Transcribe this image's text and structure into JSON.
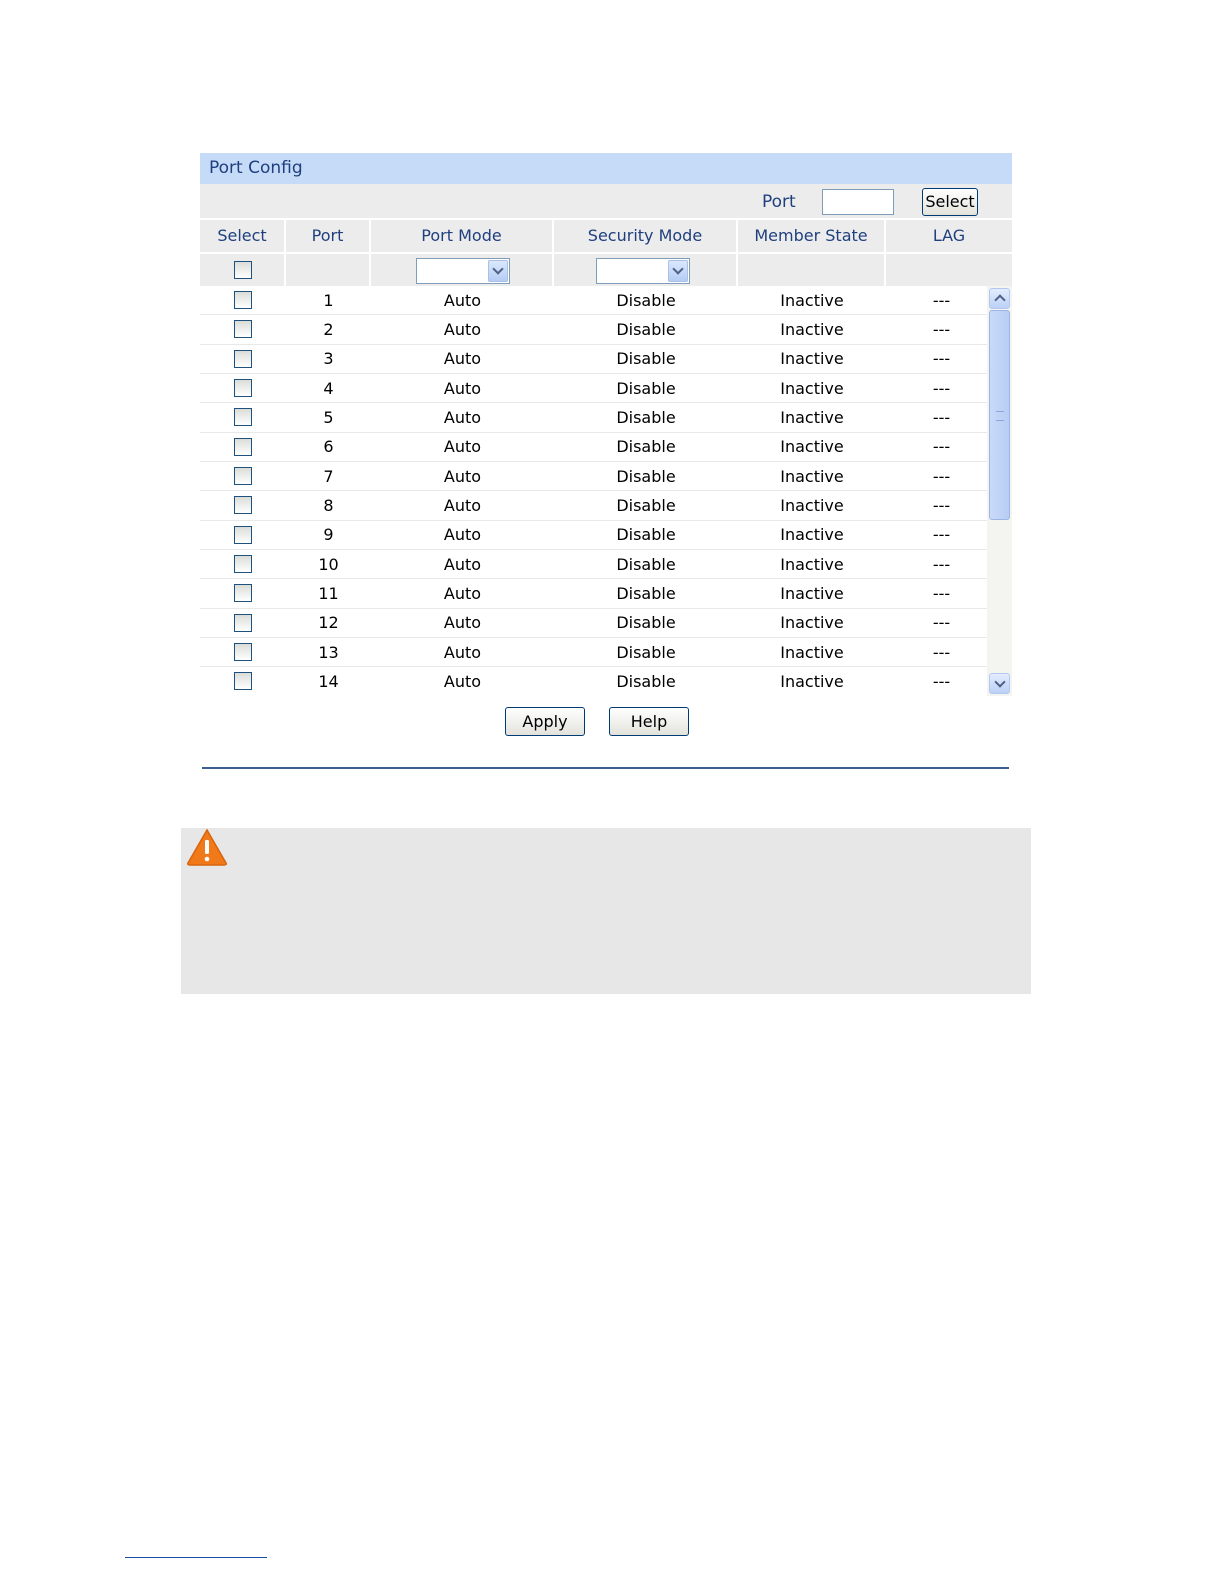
{
  "panel": {
    "title": "Port Config",
    "port_select": {
      "label": "Port",
      "input_value": "",
      "button": "Select"
    },
    "columns": [
      "Select",
      "Port",
      "Port Mode",
      "Security Mode",
      "Member State",
      "LAG"
    ],
    "rows": [
      {
        "port": "1",
        "port_mode": "Auto",
        "security_mode": "Disable",
        "member_state": "Inactive",
        "lag": "---"
      },
      {
        "port": "2",
        "port_mode": "Auto",
        "security_mode": "Disable",
        "member_state": "Inactive",
        "lag": "---"
      },
      {
        "port": "3",
        "port_mode": "Auto",
        "security_mode": "Disable",
        "member_state": "Inactive",
        "lag": "---"
      },
      {
        "port": "4",
        "port_mode": "Auto",
        "security_mode": "Disable",
        "member_state": "Inactive",
        "lag": "---"
      },
      {
        "port": "5",
        "port_mode": "Auto",
        "security_mode": "Disable",
        "member_state": "Inactive",
        "lag": "---"
      },
      {
        "port": "6",
        "port_mode": "Auto",
        "security_mode": "Disable",
        "member_state": "Inactive",
        "lag": "---"
      },
      {
        "port": "7",
        "port_mode": "Auto",
        "security_mode": "Disable",
        "member_state": "Inactive",
        "lag": "---"
      },
      {
        "port": "8",
        "port_mode": "Auto",
        "security_mode": "Disable",
        "member_state": "Inactive",
        "lag": "---"
      },
      {
        "port": "9",
        "port_mode": "Auto",
        "security_mode": "Disable",
        "member_state": "Inactive",
        "lag": "---"
      },
      {
        "port": "10",
        "port_mode": "Auto",
        "security_mode": "Disable",
        "member_state": "Inactive",
        "lag": "---"
      },
      {
        "port": "11",
        "port_mode": "Auto",
        "security_mode": "Disable",
        "member_state": "Inactive",
        "lag": "---"
      },
      {
        "port": "12",
        "port_mode": "Auto",
        "security_mode": "Disable",
        "member_state": "Inactive",
        "lag": "---"
      },
      {
        "port": "13",
        "port_mode": "Auto",
        "security_mode": "Disable",
        "member_state": "Inactive",
        "lag": "---"
      },
      {
        "port": "14",
        "port_mode": "Auto",
        "security_mode": "Disable",
        "member_state": "Inactive",
        "lag": "---"
      }
    ],
    "filters": {
      "port_mode": "",
      "security_mode": ""
    }
  },
  "actions": {
    "apply": "Apply",
    "help": "Help"
  },
  "icons": {
    "warning": "warning-icon"
  },
  "colors": {
    "title_bar": "#c5dbf7",
    "header_text": "#1f3f7f",
    "warning_orange": "#f07a1a",
    "divider": "#3c5f8f"
  }
}
